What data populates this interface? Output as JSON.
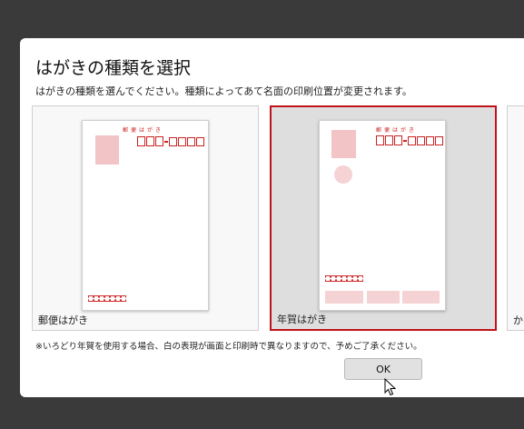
{
  "dialog": {
    "title": "はがきの種類を選択",
    "subtitle": "はがきの種類を選んでください。種類によってあて名面の印刷位置が変更されます。",
    "note": "※いろどり年賀を使用する場合、白の表現が画面と印刷時で異なりますので、予めご了承ください。",
    "ok_label": "OK"
  },
  "cards": [
    {
      "label": "郵便はがき",
      "header": "郵便はがき",
      "selected": false
    },
    {
      "label": "年賀はがき",
      "header": "郵便はがき",
      "selected": true
    },
    {
      "label": "か",
      "selected": false
    }
  ],
  "colors": {
    "accent": "#c0121a",
    "postcard_red": "#cc2222",
    "stamp_pink": "#f2c4c6"
  }
}
